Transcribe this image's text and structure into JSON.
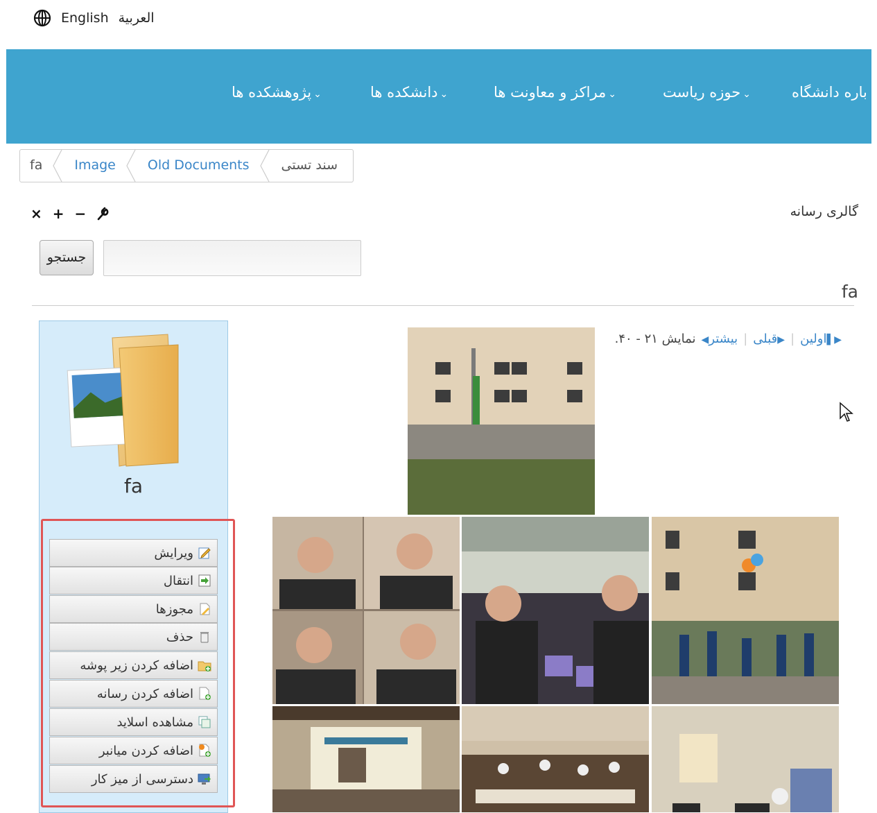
{
  "language_bar": {
    "english": "English",
    "arabic": "العربية",
    "icon": "globe-icon"
  },
  "nav": {
    "items": [
      {
        "label": "پژوهشکده ها",
        "icon": "chevron-down-icon"
      },
      {
        "label": "دانشکده ها",
        "icon": "chevron-down-icon"
      },
      {
        "label": "مراکز و معاونت ها",
        "icon": "chevron-down-icon"
      },
      {
        "label": "حوزه ریاست",
        "icon": "chevron-down-icon"
      },
      {
        "label": "باره دانشگاه"
      }
    ],
    "color": "#3fa4cf"
  },
  "breadcrumb": [
    "fa",
    "Image",
    "Old Documents",
    "سند تستی"
  ],
  "gallery_title": "گالری رسانه",
  "tools": [
    "×",
    "+",
    "−",
    "wrench-icon"
  ],
  "search": {
    "button": "جستجو",
    "value": ""
  },
  "folder_heading": "fa",
  "pager": {
    "first": "اولین",
    "prev": "قبلی",
    "next": "بیشتر",
    "info": "نمایش ۲۱ - ۴۰."
  },
  "folder": {
    "name": "fa",
    "icon": "folder-images-icon"
  },
  "actions": [
    {
      "label": "ویرایش",
      "icon": "edit-icon"
    },
    {
      "label": "انتقال",
      "icon": "move-icon"
    },
    {
      "label": "مجوزها",
      "icon": "permissions-icon"
    },
    {
      "label": "حذف",
      "icon": "trash-icon"
    },
    {
      "label": "اضافه کردن زیر پوشه",
      "icon": "add-subfolder-icon"
    },
    {
      "label": "اضافه کردن رسانه",
      "icon": "add-media-icon"
    },
    {
      "label": "مشاهده اسلاید",
      "icon": "slideshow-icon"
    },
    {
      "label": "اضافه کردن میانبر",
      "icon": "add-shortcut-icon"
    },
    {
      "label": "دسترسی از میز کار",
      "icon": "desktop-access-icon"
    }
  ],
  "colors": {
    "link": "#3a86c8",
    "highlight": "#e05555",
    "panel": "#d6ecfa"
  }
}
